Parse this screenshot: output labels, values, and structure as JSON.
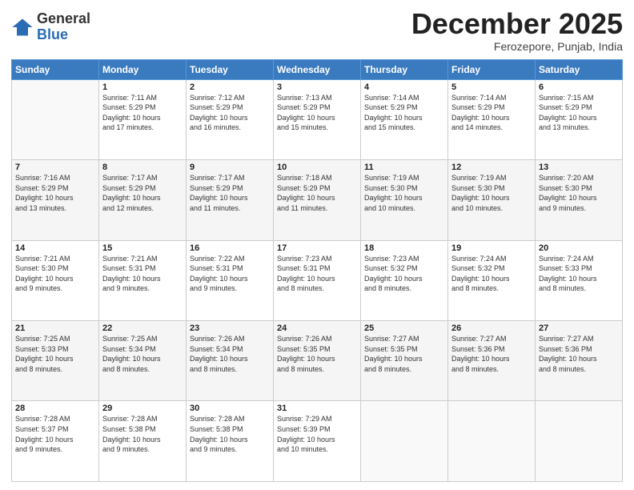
{
  "logo": {
    "general": "General",
    "blue": "Blue"
  },
  "header": {
    "month": "December 2025",
    "location": "Ferozepore, Punjab, India"
  },
  "days_of_week": [
    "Sunday",
    "Monday",
    "Tuesday",
    "Wednesday",
    "Thursday",
    "Friday",
    "Saturday"
  ],
  "weeks": [
    [
      {
        "day": "",
        "info": ""
      },
      {
        "day": "1",
        "info": "Sunrise: 7:11 AM\nSunset: 5:29 PM\nDaylight: 10 hours\nand 17 minutes."
      },
      {
        "day": "2",
        "info": "Sunrise: 7:12 AM\nSunset: 5:29 PM\nDaylight: 10 hours\nand 16 minutes."
      },
      {
        "day": "3",
        "info": "Sunrise: 7:13 AM\nSunset: 5:29 PM\nDaylight: 10 hours\nand 15 minutes."
      },
      {
        "day": "4",
        "info": "Sunrise: 7:14 AM\nSunset: 5:29 PM\nDaylight: 10 hours\nand 15 minutes."
      },
      {
        "day": "5",
        "info": "Sunrise: 7:14 AM\nSunset: 5:29 PM\nDaylight: 10 hours\nand 14 minutes."
      },
      {
        "day": "6",
        "info": "Sunrise: 7:15 AM\nSunset: 5:29 PM\nDaylight: 10 hours\nand 13 minutes."
      }
    ],
    [
      {
        "day": "7",
        "info": "Sunrise: 7:16 AM\nSunset: 5:29 PM\nDaylight: 10 hours\nand 13 minutes."
      },
      {
        "day": "8",
        "info": "Sunrise: 7:17 AM\nSunset: 5:29 PM\nDaylight: 10 hours\nand 12 minutes."
      },
      {
        "day": "9",
        "info": "Sunrise: 7:17 AM\nSunset: 5:29 PM\nDaylight: 10 hours\nand 11 minutes."
      },
      {
        "day": "10",
        "info": "Sunrise: 7:18 AM\nSunset: 5:29 PM\nDaylight: 10 hours\nand 11 minutes."
      },
      {
        "day": "11",
        "info": "Sunrise: 7:19 AM\nSunset: 5:30 PM\nDaylight: 10 hours\nand 10 minutes."
      },
      {
        "day": "12",
        "info": "Sunrise: 7:19 AM\nSunset: 5:30 PM\nDaylight: 10 hours\nand 10 minutes."
      },
      {
        "day": "13",
        "info": "Sunrise: 7:20 AM\nSunset: 5:30 PM\nDaylight: 10 hours\nand 9 minutes."
      }
    ],
    [
      {
        "day": "14",
        "info": "Sunrise: 7:21 AM\nSunset: 5:30 PM\nDaylight: 10 hours\nand 9 minutes."
      },
      {
        "day": "15",
        "info": "Sunrise: 7:21 AM\nSunset: 5:31 PM\nDaylight: 10 hours\nand 9 minutes."
      },
      {
        "day": "16",
        "info": "Sunrise: 7:22 AM\nSunset: 5:31 PM\nDaylight: 10 hours\nand 9 minutes."
      },
      {
        "day": "17",
        "info": "Sunrise: 7:23 AM\nSunset: 5:31 PM\nDaylight: 10 hours\nand 8 minutes."
      },
      {
        "day": "18",
        "info": "Sunrise: 7:23 AM\nSunset: 5:32 PM\nDaylight: 10 hours\nand 8 minutes."
      },
      {
        "day": "19",
        "info": "Sunrise: 7:24 AM\nSunset: 5:32 PM\nDaylight: 10 hours\nand 8 minutes."
      },
      {
        "day": "20",
        "info": "Sunrise: 7:24 AM\nSunset: 5:33 PM\nDaylight: 10 hours\nand 8 minutes."
      }
    ],
    [
      {
        "day": "21",
        "info": "Sunrise: 7:25 AM\nSunset: 5:33 PM\nDaylight: 10 hours\nand 8 minutes."
      },
      {
        "day": "22",
        "info": "Sunrise: 7:25 AM\nSunset: 5:34 PM\nDaylight: 10 hours\nand 8 minutes."
      },
      {
        "day": "23",
        "info": "Sunrise: 7:26 AM\nSunset: 5:34 PM\nDaylight: 10 hours\nand 8 minutes."
      },
      {
        "day": "24",
        "info": "Sunrise: 7:26 AM\nSunset: 5:35 PM\nDaylight: 10 hours\nand 8 minutes."
      },
      {
        "day": "25",
        "info": "Sunrise: 7:27 AM\nSunset: 5:35 PM\nDaylight: 10 hours\nand 8 minutes."
      },
      {
        "day": "26",
        "info": "Sunrise: 7:27 AM\nSunset: 5:36 PM\nDaylight: 10 hours\nand 8 minutes."
      },
      {
        "day": "27",
        "info": "Sunrise: 7:27 AM\nSunset: 5:36 PM\nDaylight: 10 hours\nand 8 minutes."
      }
    ],
    [
      {
        "day": "28",
        "info": "Sunrise: 7:28 AM\nSunset: 5:37 PM\nDaylight: 10 hours\nand 9 minutes."
      },
      {
        "day": "29",
        "info": "Sunrise: 7:28 AM\nSunset: 5:38 PM\nDaylight: 10 hours\nand 9 minutes."
      },
      {
        "day": "30",
        "info": "Sunrise: 7:28 AM\nSunset: 5:38 PM\nDaylight: 10 hours\nand 9 minutes."
      },
      {
        "day": "31",
        "info": "Sunrise: 7:29 AM\nSunset: 5:39 PM\nDaylight: 10 hours\nand 10 minutes."
      },
      {
        "day": "",
        "info": ""
      },
      {
        "day": "",
        "info": ""
      },
      {
        "day": "",
        "info": ""
      }
    ]
  ]
}
